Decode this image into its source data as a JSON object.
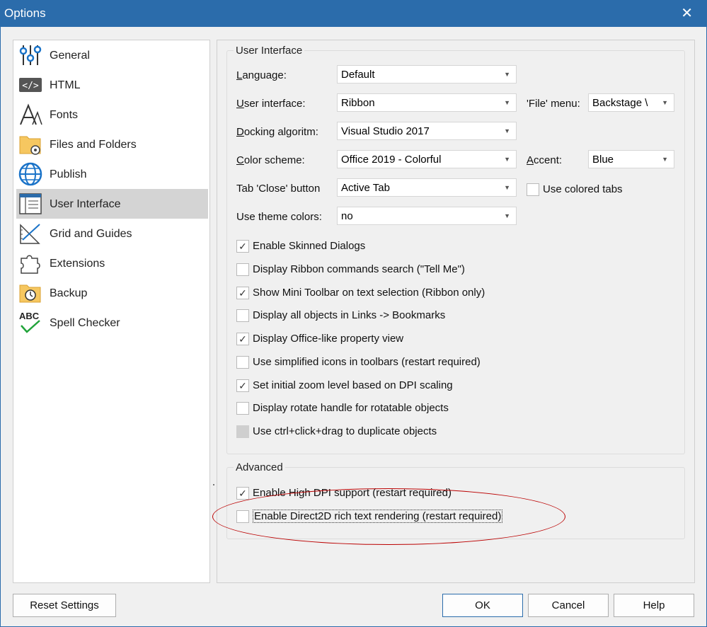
{
  "window": {
    "title": "Options",
    "close_glyph": "✕"
  },
  "nav": {
    "items": [
      {
        "label": "General",
        "icon": "sliders-icon"
      },
      {
        "label": "HTML",
        "icon": "html-code-icon",
        "badge": "</>"
      },
      {
        "label": "Fonts",
        "icon": "font-icon"
      },
      {
        "label": "Files and Folders",
        "icon": "folder-gear-icon"
      },
      {
        "label": "Publish",
        "icon": "globe-icon"
      },
      {
        "label": "User Interface",
        "icon": "window-layout-icon",
        "selected": true
      },
      {
        "label": "Grid and Guides",
        "icon": "ruler-triangle-icon"
      },
      {
        "label": "Extensions",
        "icon": "puzzle-icon"
      },
      {
        "label": "Backup",
        "icon": "backup-clock-icon"
      },
      {
        "label": "Spell Checker",
        "icon": "abc-check-icon",
        "badge": "ABC"
      }
    ]
  },
  "ui_group": {
    "title": "User Interface",
    "language": {
      "label_u": "L",
      "label_rest": "anguage:",
      "value": "Default"
    },
    "user_interface": {
      "label_u": "U",
      "label_rest": "ser interface:",
      "value": "Ribbon"
    },
    "file_menu": {
      "label": "'File' menu:",
      "value": "Backstage \\"
    },
    "docking": {
      "label_u": "D",
      "label_rest": "ocking algoritm:",
      "value": "Visual Studio 2017"
    },
    "color_scheme": {
      "label_u": "C",
      "label_rest": "olor scheme:",
      "value": "Office 2019 - Colorful"
    },
    "accent": {
      "label_u": "A",
      "label_rest": "ccent:",
      "value": "Blue"
    },
    "tab_close": {
      "label": "Tab 'Close' button",
      "value": "Active Tab"
    },
    "colored_tabs": {
      "label": "Use colored tabs",
      "checked": false
    },
    "theme_colors": {
      "label": "Use theme colors:",
      "value": "no"
    },
    "checkboxes": [
      {
        "label": "Enable Skinned Dialogs",
        "checked": true
      },
      {
        "label": "Display Ribbon commands search (\"Tell Me\")",
        "checked": false
      },
      {
        "label": "Show Mini Toolbar on text selection (Ribbon only)",
        "checked": true
      },
      {
        "label": "Display all objects in Links -> Bookmarks",
        "checked": false
      },
      {
        "label": "Display Office-like property view",
        "checked": true
      },
      {
        "label": "Use simplified icons in toolbars (restart required)",
        "checked": false
      },
      {
        "label": "Set initial zoom level based on DPI scaling",
        "checked": true
      },
      {
        "label": "Display rotate handle for rotatable objects",
        "checked": false
      },
      {
        "label": "Use ctrl+click+drag to duplicate objects",
        "checked": false,
        "disabled": true
      }
    ]
  },
  "advanced_group": {
    "title": "Advanced",
    "checkboxes": [
      {
        "label": "Enable High DPI support (restart required)",
        "checked": true
      },
      {
        "label": "Enable Direct2D rich text rendering (restart required)",
        "checked": false
      }
    ]
  },
  "buttons": {
    "reset": "Reset Settings",
    "ok": "OK",
    "cancel": "Cancel",
    "help": "Help"
  },
  "glyphs": {
    "check": "✓",
    "arrow": "▼"
  },
  "colors": {
    "titlebar": "#2b6cab",
    "selection": "#d4d4d4",
    "annotation_oval": "#bb0000"
  }
}
